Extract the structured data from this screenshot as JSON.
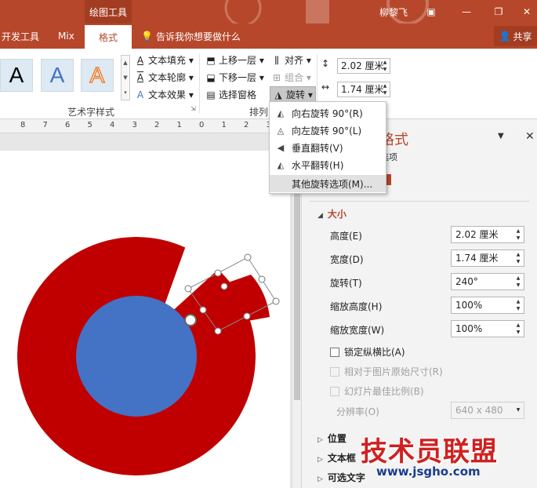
{
  "titlebar": {
    "context_tab": "绘图工具",
    "user": "柳黎飞"
  },
  "tabs": {
    "dev": "开发工具",
    "mix": "Mix",
    "format": "格式",
    "tell_me": "告诉我你想要做什么",
    "share": "共享"
  },
  "ribbon": {
    "wordart_letters": [
      "A",
      "A",
      "A"
    ],
    "text_fill": "文本填充",
    "text_outline": "文本轮廓",
    "text_effects": "文本效果",
    "wordart_group": "艺术字样式",
    "bring_forward": "上移一层",
    "send_backward": "下移一层",
    "selection_pane": "选择窗格",
    "align": "对齐",
    "group": "组合",
    "rotate": "旋转",
    "arrange_group": "排列",
    "height_value": "2.02 厘米",
    "width_value": "1.74 厘米"
  },
  "ruler_ticks": [
    "8",
    "7",
    "6",
    "5",
    "4",
    "3",
    "2",
    "1",
    "0",
    "1",
    "2",
    "3",
    "4"
  ],
  "rotate_menu": {
    "items": [
      {
        "label": "向右旋转 90°(R)",
        "icon": "rotate-right-icon"
      },
      {
        "label": "向左旋转 90°(L)",
        "icon": "rotate-left-icon"
      },
      {
        "label": "垂直翻转(V)",
        "icon": "flip-vertical-icon"
      },
      {
        "label": "水平翻转(H)",
        "icon": "flip-horizontal-icon"
      },
      {
        "label": "其他旋转选项(M)...",
        "icon": ""
      }
    ]
  },
  "pane": {
    "title": "格式",
    "subtitle": "选项",
    "size_section": "大小",
    "height_label": "高度(E)",
    "height_value": "2.02 厘米",
    "width_label": "宽度(D)",
    "width_value": "1.74 厘米",
    "rotation_label": "旋转(T)",
    "rotation_value": "240°",
    "scale_h_label": "缩放高度(H)",
    "scale_h_value": "100%",
    "scale_w_label": "缩放宽度(W)",
    "scale_w_value": "100%",
    "lock_aspect": "锁定纵横比(A)",
    "relative_original": "相对于图片原始尺寸(R)",
    "best_scale": "幻灯片最佳比例(B)",
    "resolution_label": "分辨率(O)",
    "resolution_value": "640 x 480",
    "position_section": "位置",
    "textbox_section": "文本框",
    "alt_text_section": "可选文字"
  },
  "watermark": {
    "text": "技术员联盟",
    "url": "www.jsgho.com"
  },
  "colors": {
    "accent": "#b7472a",
    "petal": "#c00000",
    "center": "#4472c4"
  }
}
